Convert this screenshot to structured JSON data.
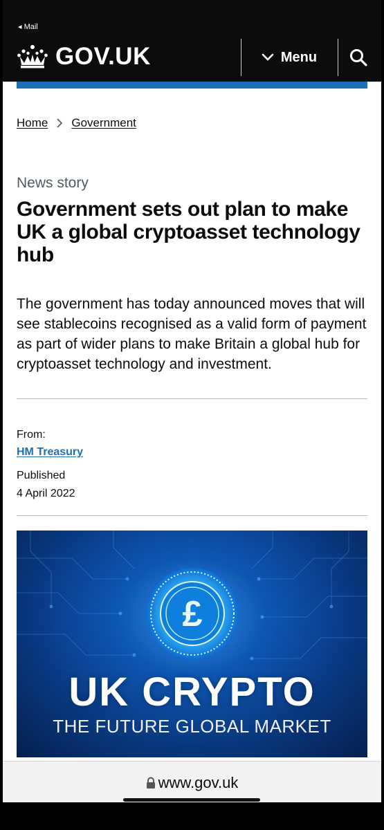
{
  "status": {
    "back_label": "◂ Mail"
  },
  "header": {
    "logo_text": "GOV.UK",
    "menu_label": "Menu",
    "colors": {
      "header_bg": "#0b0c0c",
      "accent_bar": "#1d70b8"
    }
  },
  "breadcrumb": {
    "items": [
      {
        "label": "Home"
      },
      {
        "label": "Government"
      }
    ]
  },
  "article": {
    "caption": "News story",
    "title": "Government sets out plan to make UK a global cryptoasset technology hub",
    "lead": "The government has today announced moves that will see stablecoins recognised as a valid form of payment as part of wider plans to make Britain a global hub for cryptoasset technology and investment.",
    "from_label": "From:",
    "organisation": "HM Treasury",
    "published_label": "Published",
    "published_date": "4 April 2022"
  },
  "hero_image": {
    "title": "UK CRYPTO",
    "subtitle": "THE FUTURE GLOBAL MARKET",
    "coin_symbol": "£"
  },
  "browser": {
    "url": "www.gov.uk"
  }
}
